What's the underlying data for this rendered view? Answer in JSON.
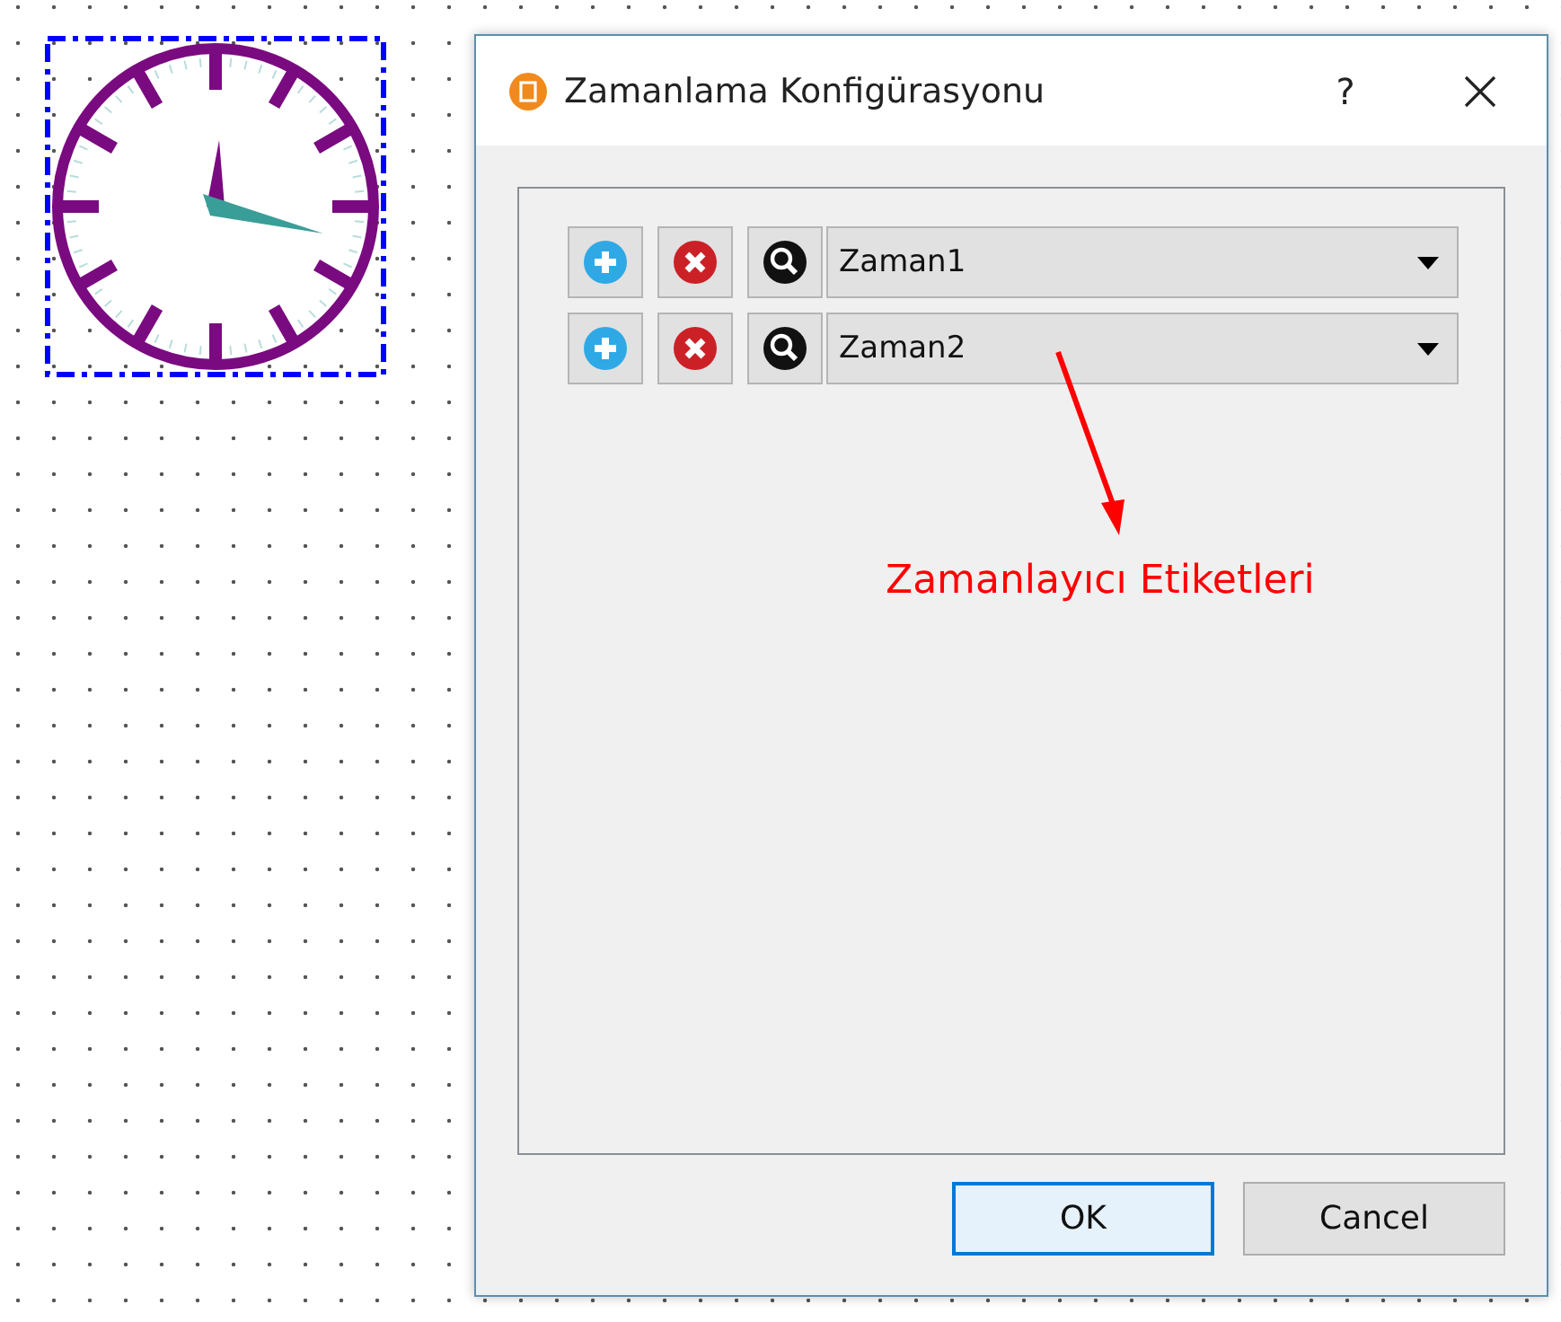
{
  "dialog": {
    "title": "Zamanlama Konfigürasyonu",
    "help": "?"
  },
  "rows": [
    {
      "value": "Zaman1"
    },
    {
      "value": "Zaman2"
    }
  ],
  "annotation": "Zamanlayıcı Etiketleri",
  "buttons": [
    {
      "label": "OK",
      "default": true
    },
    {
      "label": "Cancel",
      "default": false
    }
  ]
}
